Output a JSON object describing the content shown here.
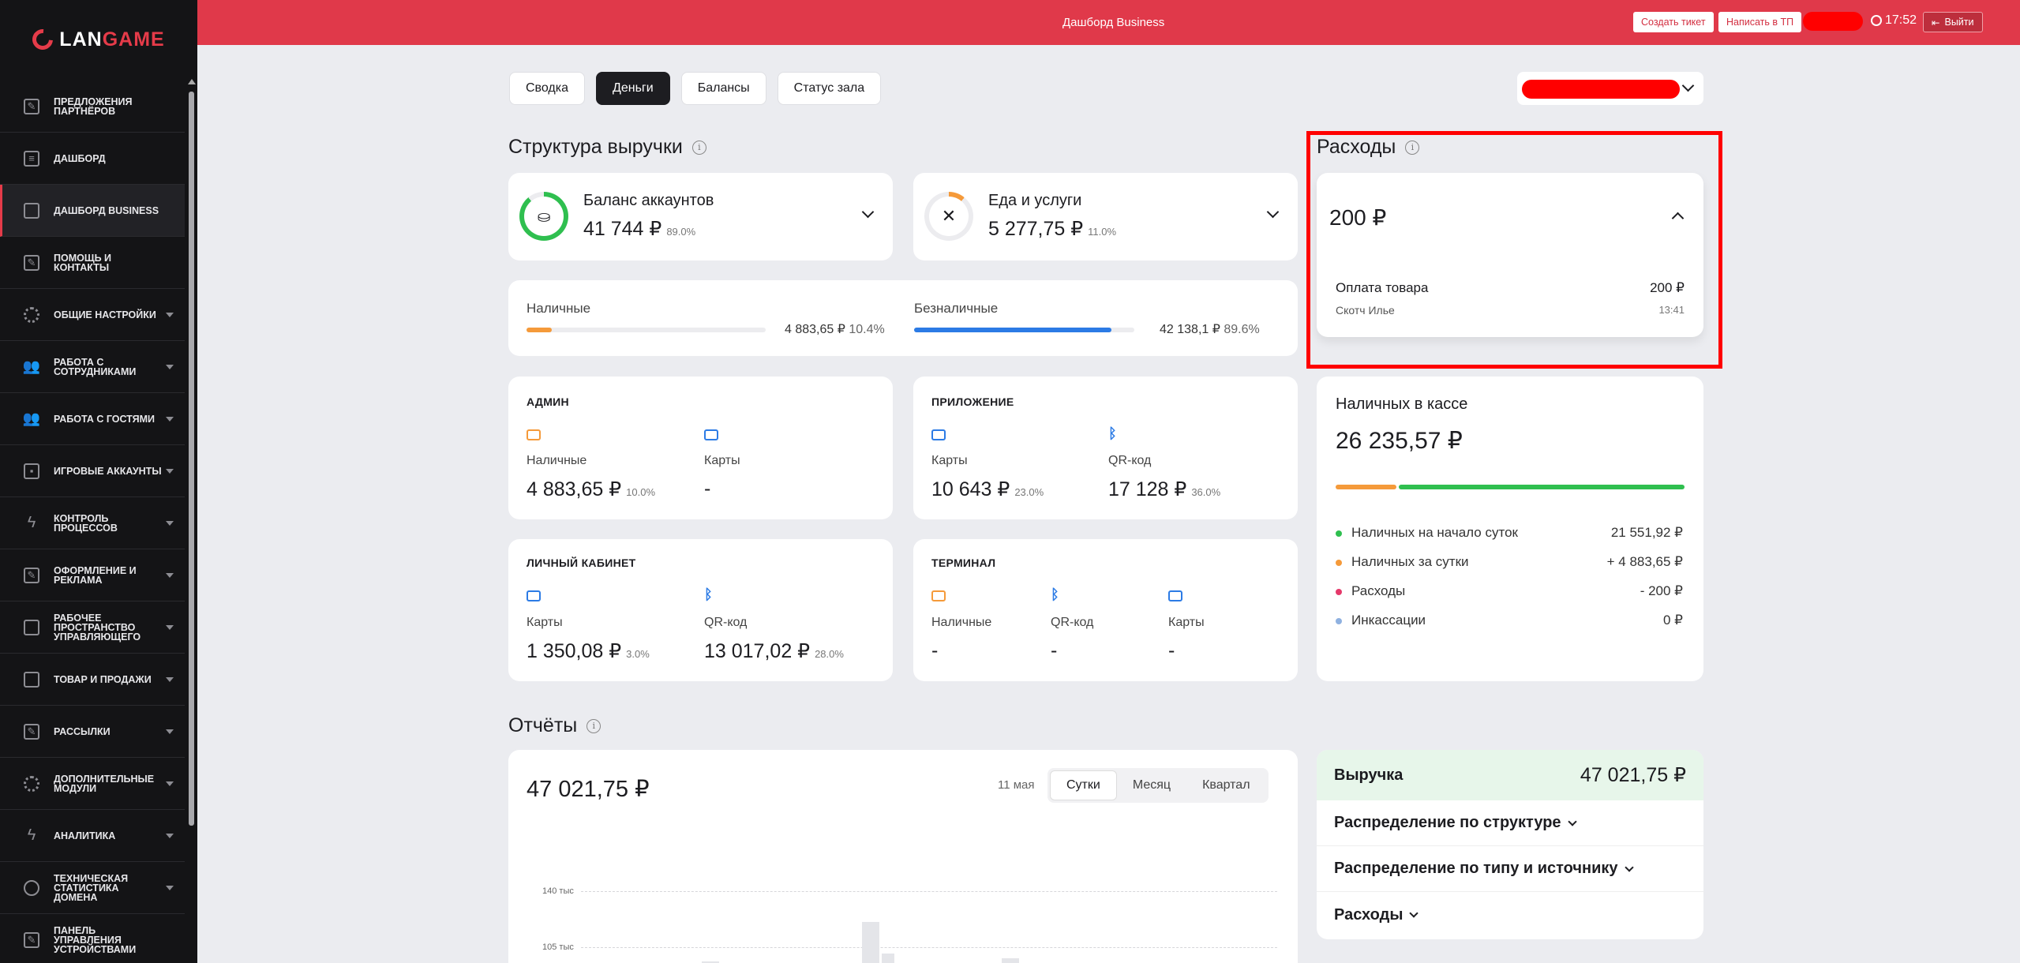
{
  "header": {
    "logo_prefix": "LAN",
    "logo_suffix": "GAME",
    "title": "Дашборд Business",
    "create_ticket": "Создать тикет",
    "write_support": "Написать в ТП",
    "time": "17:52",
    "logout": "Выйти"
  },
  "sidebar": {
    "items": [
      {
        "label": "Предложения партнёров"
      },
      {
        "label": "Дашборд"
      },
      {
        "label": "Дашборд Business"
      },
      {
        "label": "Помощь и контакты"
      },
      {
        "label": "Общие настройки"
      },
      {
        "label": "Работа с сотрудниками"
      },
      {
        "label": "Работа с гостями"
      },
      {
        "label": "Игровые аккаунты"
      },
      {
        "label": "Контроль процессов"
      },
      {
        "label": "Оформление и реклама"
      },
      {
        "label": "Рабочее пространство управляющего"
      },
      {
        "label": "Товар и продажи"
      },
      {
        "label": "Рассылки"
      },
      {
        "label": "Дополнительные модули"
      },
      {
        "label": "Аналитика"
      },
      {
        "label": "Техническая статистика домена"
      },
      {
        "label": "Панель управления устройствами"
      }
    ]
  },
  "tabs": [
    "Сводка",
    "Деньги",
    "Балансы",
    "Статус зала"
  ],
  "revenue_structure": {
    "title": "Структура выручки",
    "balance": {
      "label": "Баланс аккаунтов",
      "value": "41 744 ₽",
      "pct": "89.0%"
    },
    "food": {
      "label": "Еда и услуги",
      "value": "5 277,75 ₽",
      "pct": "11.0%"
    },
    "cash": {
      "label": "Наличные",
      "value": "4 883,65 ₽",
      "pct": "10.4%",
      "fill": 0.104
    },
    "cashless": {
      "label": "Безналичные",
      "value": "42 138,1 ₽",
      "pct": "89.6%",
      "fill": 0.896
    }
  },
  "sources": {
    "admin": {
      "title": "Админ",
      "cash_label": "Наличные",
      "cash_value": "4 883,65 ₽",
      "cash_pct": "10.0%",
      "cards_label": "Карты",
      "cards_value": "-"
    },
    "app": {
      "title": "Приложение",
      "cards_label": "Карты",
      "cards_value": "10 643 ₽",
      "cards_pct": "23.0%",
      "qr_label": "QR-код",
      "qr_value": "17 128 ₽",
      "qr_pct": "36.0%"
    },
    "cabinet": {
      "title": "Личный кабинет",
      "cards_label": "Карты",
      "cards_value": "1 350,08 ₽",
      "cards_pct": "3.0%",
      "qr_label": "QR-код",
      "qr_value": "13 017,02 ₽",
      "qr_pct": "28.0%"
    },
    "terminal": {
      "title": "Терминал",
      "cash_label": "Наличные",
      "cash_value": "-",
      "qr_label": "QR-код",
      "qr_value": "-",
      "cards_label": "Карты",
      "cards_value": "-"
    }
  },
  "expenses": {
    "title": "Расходы",
    "total": "200 ₽",
    "item_name": "Оплата товара",
    "item_amount": "200 ₽",
    "item_person": "Скотч Илье",
    "item_time": "13:41"
  },
  "cashbox": {
    "title": "Наличных в кассе",
    "total": "26 235,57 ₽",
    "rows": [
      {
        "label": "Наличных на начало суток",
        "value": "21 551,92 ₽",
        "color": "#2fbf4f"
      },
      {
        "label": "Наличных за сутки",
        "value": "+ 4 883,65 ₽",
        "color": "#f59a3a"
      },
      {
        "label": "Расходы",
        "value": "- 200 ₽",
        "color": "#e5396a"
      },
      {
        "label": "Инкассации",
        "value": "0 ₽",
        "color": "#8fb1e0"
      }
    ]
  },
  "reports": {
    "title": "Отчёты",
    "total": "47 021,75 ₽",
    "date": "11 мая",
    "periods": [
      "Сутки",
      "Месяц",
      "Квартал"
    ],
    "ticks": [
      "140 тыс",
      "105 тыс"
    ]
  },
  "revenue_summary": {
    "label": "Выручка",
    "value": "47 021,75 ₽",
    "rows": [
      "Распределение по структуре",
      "Распределение по типу и источнику",
      "Расходы"
    ]
  },
  "colors": {
    "accent": "#e0394a",
    "green": "#2fbf4f",
    "orange": "#f59a3a",
    "blue": "#2c7be5"
  }
}
